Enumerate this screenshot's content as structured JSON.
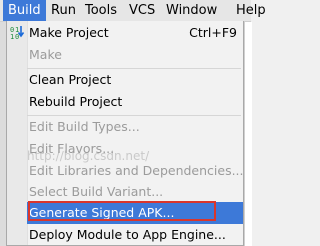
{
  "menubar": {
    "items": [
      "Build",
      "Run",
      "Tools",
      "VCS",
      "Window",
      "Help"
    ],
    "active": "Build"
  },
  "build_menu": {
    "make_project": {
      "label": "Make Project",
      "shortcut": "Ctrl+F9"
    },
    "make": "Make",
    "clean_project": "Clean Project",
    "rebuild_project": "Rebuild Project",
    "edit_build_types": "Edit Build Types...",
    "edit_flavors": "Edit Flavors...",
    "edit_libraries": "Edit Libraries and Dependencies...",
    "select_build_variant": "Select Build Variant...",
    "generate_signed_apk": "Generate Signed APK...",
    "deploy_module": "Deploy Module to App Engine..."
  },
  "watermark": "http://blog.csdn.net/",
  "colors": {
    "highlight": "#3d79d8",
    "annotation_box": "#d9362c",
    "disabled_text": "#9b9b9b"
  }
}
